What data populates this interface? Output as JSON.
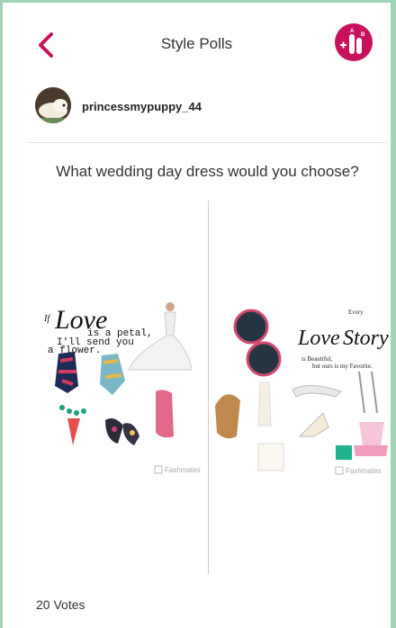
{
  "header": {
    "title": "Style Polls",
    "back_icon": "chevron-left-icon",
    "poll_icon": "compare-poll-icon"
  },
  "user": {
    "name": "princessmypuppy_44"
  },
  "poll": {
    "question": "What wedding day dress would you choose?",
    "options": [
      {
        "quote_lines": [
          "If",
          "Love",
          "is a petal,",
          "I'll send you",
          "a flower."
        ],
        "watermark": "Fashmates"
      },
      {
        "quote_lines": [
          "Every",
          "Love",
          "Story",
          "is Beautiful,",
          "but ours is my Favorite."
        ],
        "watermark": "Fashmates"
      }
    ],
    "votes": "20 Votes"
  },
  "colors": {
    "accent": "#c8115d",
    "frame": "#9fd4b5"
  }
}
